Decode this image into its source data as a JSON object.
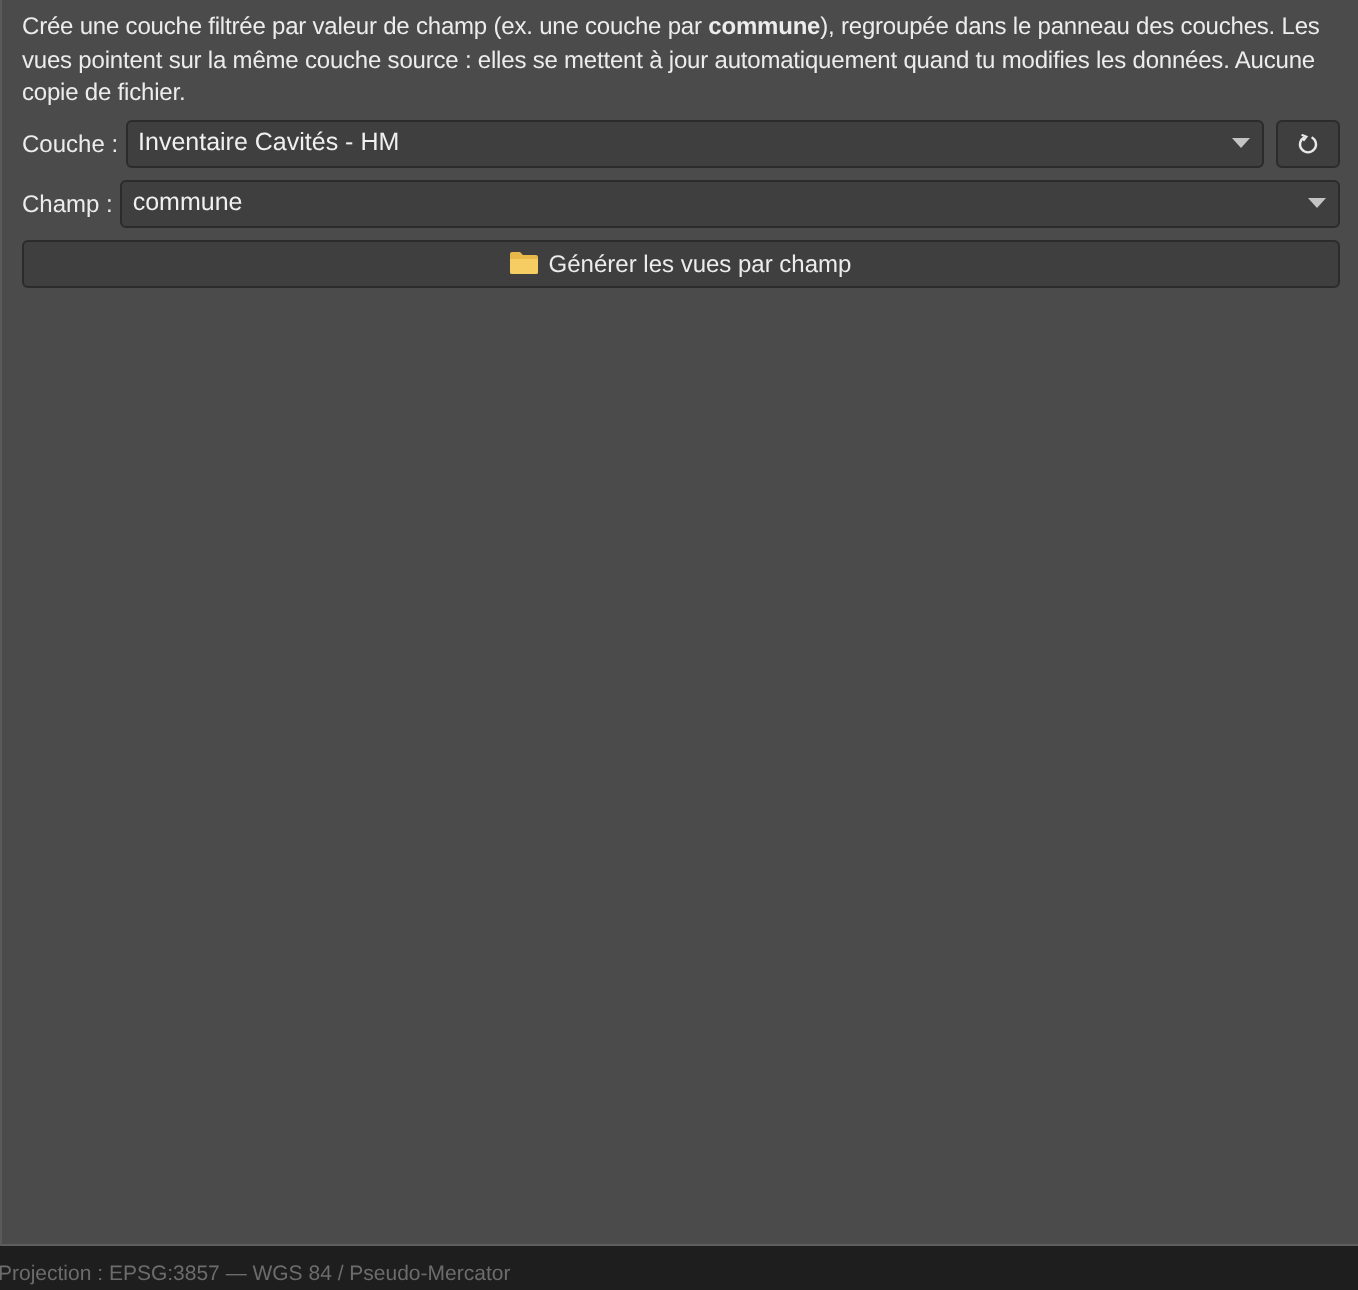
{
  "description": "Crée une couche filtrée par valeur de champ (ex. une couche par **commune**), regroupée dans le panneau des couches. Les vues pointent sur la même couche source : elles se mettent à jour automatiquement quand tu modifies les données. Aucune copie de fichier.",
  "fields": [
    {
      "label": "Couche :",
      "value": "Inventaire Cavités - HM",
      "refresh": true
    },
    {
      "label": "Champ :",
      "value": "commune",
      "refresh": false
    }
  ],
  "action_button": {
    "label": "Générer les vues par champ"
  },
  "status_bar": {
    "text": "Projection : EPSG:3857 — WGS 84 / Pseudo-Mercator"
  }
}
